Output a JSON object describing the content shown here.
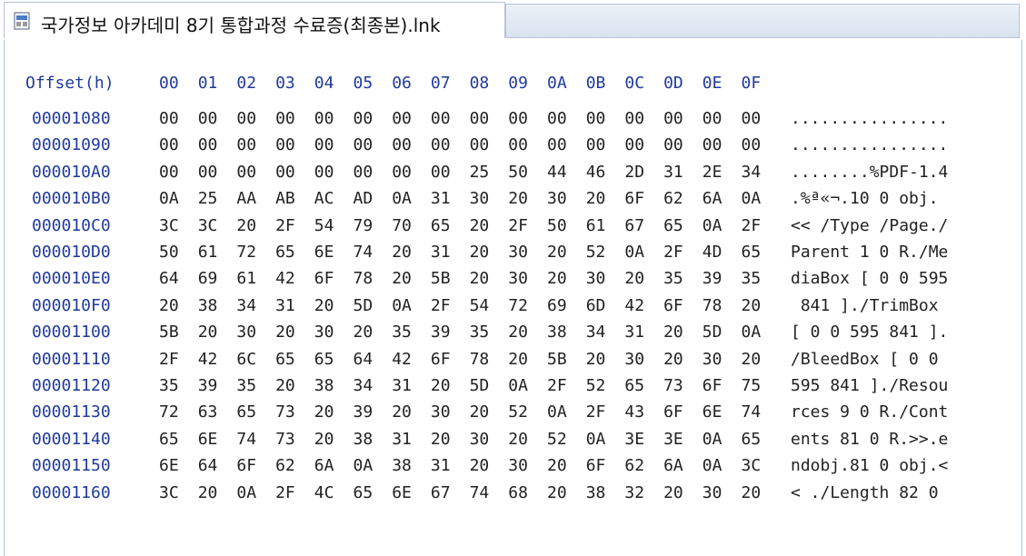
{
  "tab": {
    "icon": "shortcut-file-icon",
    "title": "국가정보 아카데미 8기 통합과정 수료증(최종본).lnk"
  },
  "header": {
    "offset_label": "Offset(h)",
    "columns": [
      "00",
      "01",
      "02",
      "03",
      "04",
      "05",
      "06",
      "07",
      "08",
      "09",
      "0A",
      "0B",
      "0C",
      "0D",
      "0E",
      "0F"
    ]
  },
  "rows": [
    {
      "offset": "00001080",
      "bytes": [
        "00",
        "00",
        "00",
        "00",
        "00",
        "00",
        "00",
        "00",
        "00",
        "00",
        "00",
        "00",
        "00",
        "00",
        "00",
        "00"
      ],
      "ascii": "................"
    },
    {
      "offset": "00001090",
      "bytes": [
        "00",
        "00",
        "00",
        "00",
        "00",
        "00",
        "00",
        "00",
        "00",
        "00",
        "00",
        "00",
        "00",
        "00",
        "00",
        "00"
      ],
      "ascii": "................"
    },
    {
      "offset": "000010A0",
      "bytes": [
        "00",
        "00",
        "00",
        "00",
        "00",
        "00",
        "00",
        "00",
        "25",
        "50",
        "44",
        "46",
        "2D",
        "31",
        "2E",
        "34"
      ],
      "ascii": "........%PDF-1.4"
    },
    {
      "offset": "000010B0",
      "bytes": [
        "0A",
        "25",
        "AA",
        "AB",
        "AC",
        "AD",
        "0A",
        "31",
        "30",
        "20",
        "30",
        "20",
        "6F",
        "62",
        "6A",
        "0A"
      ],
      "ascii": ".%ª«¬­.10 0 obj."
    },
    {
      "offset": "000010C0",
      "bytes": [
        "3C",
        "3C",
        "20",
        "2F",
        "54",
        "79",
        "70",
        "65",
        "20",
        "2F",
        "50",
        "61",
        "67",
        "65",
        "0A",
        "2F"
      ],
      "ascii": "<< /Type /Page./"
    },
    {
      "offset": "000010D0",
      "bytes": [
        "50",
        "61",
        "72",
        "65",
        "6E",
        "74",
        "20",
        "31",
        "20",
        "30",
        "20",
        "52",
        "0A",
        "2F",
        "4D",
        "65"
      ],
      "ascii": "Parent 1 0 R./Me"
    },
    {
      "offset": "000010E0",
      "bytes": [
        "64",
        "69",
        "61",
        "42",
        "6F",
        "78",
        "20",
        "5B",
        "20",
        "30",
        "20",
        "30",
        "20",
        "35",
        "39",
        "35"
      ],
      "ascii": "diaBox [ 0 0 595"
    },
    {
      "offset": "000010F0",
      "bytes": [
        "20",
        "38",
        "34",
        "31",
        "20",
        "5D",
        "0A",
        "2F",
        "54",
        "72",
        "69",
        "6D",
        "42",
        "6F",
        "78",
        "20"
      ],
      "ascii": " 841 ]./TrimBox "
    },
    {
      "offset": "00001100",
      "bytes": [
        "5B",
        "20",
        "30",
        "20",
        "30",
        "20",
        "35",
        "39",
        "35",
        "20",
        "38",
        "34",
        "31",
        "20",
        "5D",
        "0A"
      ],
      "ascii": "[ 0 0 595 841 ]."
    },
    {
      "offset": "00001110",
      "bytes": [
        "2F",
        "42",
        "6C",
        "65",
        "65",
        "64",
        "42",
        "6F",
        "78",
        "20",
        "5B",
        "20",
        "30",
        "20",
        "30",
        "20"
      ],
      "ascii": "/BleedBox [ 0 0 "
    },
    {
      "offset": "00001120",
      "bytes": [
        "35",
        "39",
        "35",
        "20",
        "38",
        "34",
        "31",
        "20",
        "5D",
        "0A",
        "2F",
        "52",
        "65",
        "73",
        "6F",
        "75"
      ],
      "ascii": "595 841 ]./Resou"
    },
    {
      "offset": "00001130",
      "bytes": [
        "72",
        "63",
        "65",
        "73",
        "20",
        "39",
        "20",
        "30",
        "20",
        "52",
        "0A",
        "2F",
        "43",
        "6F",
        "6E",
        "74"
      ],
      "ascii": "rces 9 0 R./Cont"
    },
    {
      "offset": "00001140",
      "bytes": [
        "65",
        "6E",
        "74",
        "73",
        "20",
        "38",
        "31",
        "20",
        "30",
        "20",
        "52",
        "0A",
        "3E",
        "3E",
        "0A",
        "65"
      ],
      "ascii": "ents 81 0 R.>>.e"
    },
    {
      "offset": "00001150",
      "bytes": [
        "6E",
        "64",
        "6F",
        "62",
        "6A",
        "0A",
        "38",
        "31",
        "20",
        "30",
        "20",
        "6F",
        "62",
        "6A",
        "0A",
        "3C"
      ],
      "ascii": "ndobj.81 0 obj.<"
    },
    {
      "offset": "00001160",
      "bytes": [
        "3C",
        "20",
        "0A",
        "2F",
        "4C",
        "65",
        "6E",
        "67",
        "74",
        "68",
        "20",
        "38",
        "32",
        "20",
        "30",
        "20"
      ],
      "ascii": "< ./Length 82 0 "
    }
  ]
}
